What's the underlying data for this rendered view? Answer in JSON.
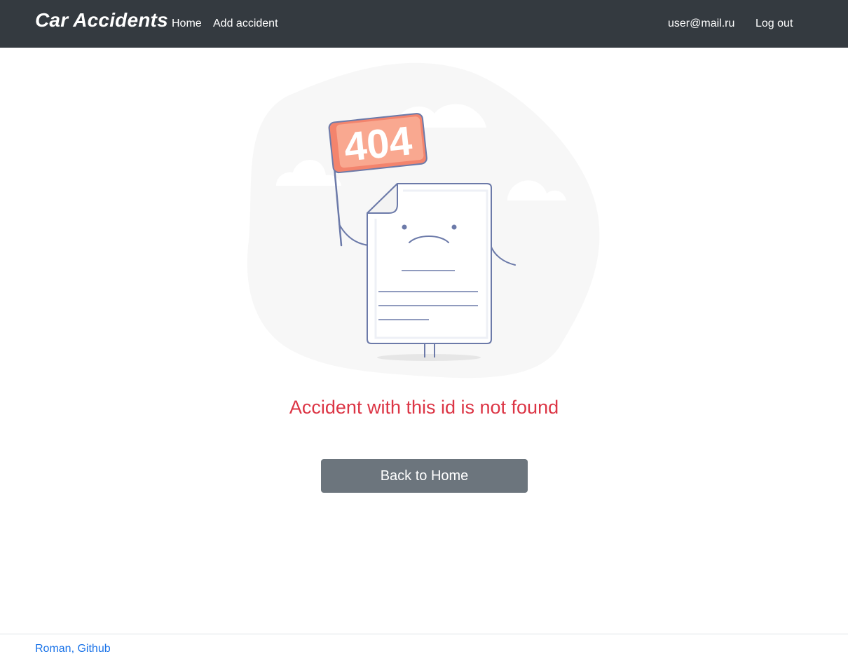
{
  "navbar": {
    "brand": "Car Accidents",
    "links": [
      {
        "label": "Home"
      },
      {
        "label": "Add accident"
      }
    ],
    "user_email": "user@mail.ru",
    "logout_label": "Log out",
    "background": "#343a40"
  },
  "illustration": {
    "flag_text": "404",
    "flag_color": "#f7a38b",
    "line_color": "#6c7aa9",
    "blob_color": "#f7f7f7"
  },
  "main": {
    "error_message": "Accident with this id is not found",
    "error_color": "#dc3545",
    "back_button_label": "Back to Home",
    "back_button_color": "#6c757d"
  },
  "footer": {
    "link_text": "Roman, Github",
    "link_color": "#1a73e8"
  }
}
